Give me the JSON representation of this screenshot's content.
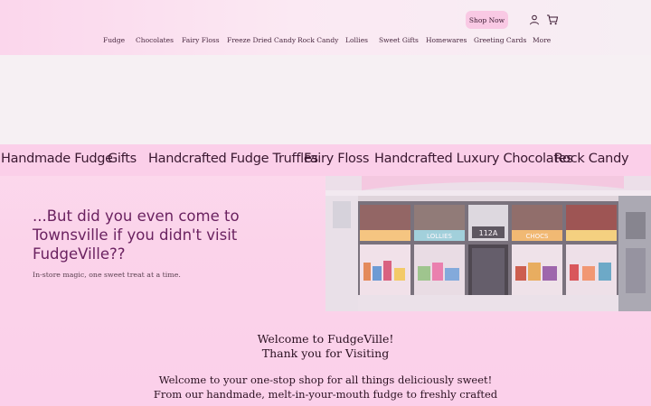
{
  "header": {
    "shop_now_label": "Shop Now",
    "account_icon": "user-icon",
    "cart_icon": "cart-icon"
  },
  "nav": {
    "items": [
      {
        "label": "Fudge"
      },
      {
        "label": "Chocolates"
      },
      {
        "label": "Fairy Floss"
      },
      {
        "label": "Freeze Dried Candy"
      },
      {
        "label": "Rock Candy"
      },
      {
        "label": "Lollies"
      },
      {
        "label": "Sweet Gifts"
      },
      {
        "label": "Homewares"
      },
      {
        "label": "Greeting Cards"
      },
      {
        "label": "More"
      }
    ]
  },
  "ticker": {
    "items": [
      "Handmade Fudge",
      "Gifts",
      "Handcrafted Fudge Truffles",
      "Fairy Floss",
      "Handcrafted Luxury Chocolates",
      "Rock Candy"
    ]
  },
  "visit": {
    "title": "...But did you even come to Townsville if you didn't visit FudgeVille??",
    "subtitle": "In-store magic, one sweet treat at a time."
  },
  "storefront": {
    "signs": [
      "LOLLIES",
      "CHOCS",
      "112A"
    ]
  },
  "welcome": {
    "line1": "Welcome to FudgeVille!",
    "line2": "Thank you for Visiting",
    "body1": "Welcome to your one-stop shop for all things deliciously sweet!",
    "body2": "From our handmade, melt-in-your-mouth fudge to freshly crafted"
  },
  "colors": {
    "accent_pink": "#fbcfe9",
    "shop_now_bg": "#f9c9e4",
    "headline_purple": "#6a2260"
  }
}
